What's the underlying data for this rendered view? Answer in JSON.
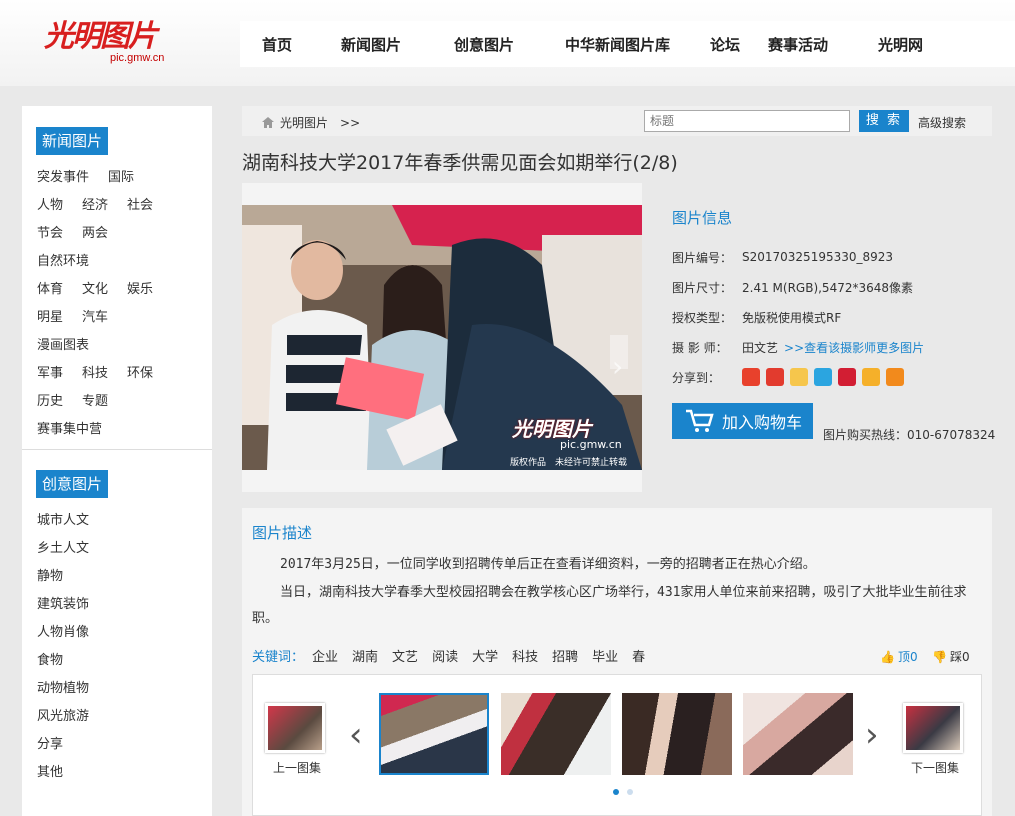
{
  "site": {
    "logo_text": "光明图片",
    "logo_url": "pic.gmw.cn"
  },
  "nav": [
    "首页",
    "新闻图片",
    "创意图片",
    "中华新闻图片库",
    "论坛",
    "赛事活动",
    "光明网"
  ],
  "sidebar": {
    "news_heading": "新闻图片",
    "news_rows": [
      [
        "突发事件",
        "国际"
      ],
      [
        "人物",
        "经济",
        "社会"
      ],
      [
        "节会",
        "两会"
      ],
      [
        "自然环境"
      ],
      [
        "体育",
        "文化",
        "娱乐"
      ],
      [
        "明星",
        "汽车"
      ],
      [
        "漫画图表"
      ],
      [
        "军事",
        "科技",
        "环保"
      ],
      [
        "历史",
        "专题"
      ],
      [
        "赛事集中营"
      ]
    ],
    "creative_heading": "创意图片",
    "creative_items": [
      "城市人文",
      "乡土人文",
      "静物",
      "建筑装饰",
      "人物肖像",
      "食物",
      "动物植物",
      "风光旅游",
      "分享",
      "其他"
    ]
  },
  "breadcrumb": {
    "home": "光明图片",
    "sep": ">>"
  },
  "search": {
    "placeholder": "标题",
    "button": "搜 索",
    "advanced": "高级搜索"
  },
  "title": "湖南科技大学2017年春季供需见面会如期举行(2/8)",
  "photo": {
    "watermark": "光明图片",
    "watermark_url": "pic.gmw.cn",
    "copyright": "版权作品　未经许可禁止转载"
  },
  "info": {
    "heading": "图片信息",
    "id_label": "图片编号：",
    "id_value": "S20170325195330_8923",
    "size_label": "图片尺寸：",
    "size_value": "2.41 M(RGB),5472*3648像素",
    "license_label": "授权类型：",
    "license_value": "免版税使用模式RF",
    "photographer_label": "摄 影 师：",
    "photographer_value": "田文艺",
    "photographer_link": ">>查看该摄影师更多图片",
    "share_label": "分享到：",
    "share_icons": [
      "sina-icon",
      "qzone-icon",
      "weibo-icon",
      "wechat-icon",
      "renren-icon",
      "baidu-icon",
      "douban-icon"
    ],
    "cart_label": "加入购物车",
    "hotline": "图片购买热线：010-67078324"
  },
  "description": {
    "heading": "图片描述",
    "p1": "2017年3月25日，一位同学收到招聘传单后正在查看详细资料，一旁的招聘者正在热心介绍。",
    "p2": "当日，湖南科技大学春季大型校园招聘会在教学核心区广场举行，431家用人单位来前来招聘，吸引了大批毕业生前往求职。",
    "keywords_label": "关键词：",
    "keywords": [
      "企业",
      "湖南",
      "文艺",
      "阅读",
      "大学",
      "科技",
      "招聘",
      "毕业",
      "春"
    ],
    "up_label": "顶0",
    "down_label": "踩0"
  },
  "gallery": {
    "prev_label": "上一图集",
    "next_label": "下一图集",
    "selected_index": 0,
    "dot_count": 2
  },
  "colors": {
    "accent": "#1a84cc",
    "brand_red": "#d81f1f"
  }
}
